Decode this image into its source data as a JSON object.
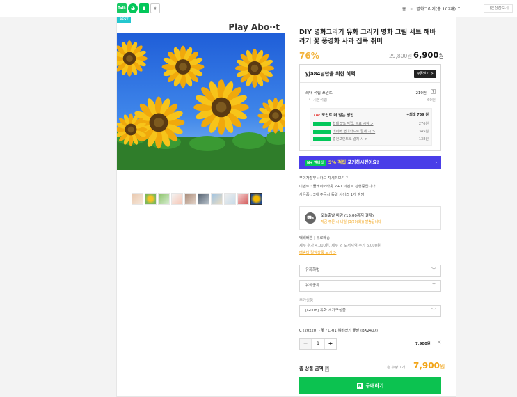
{
  "topbar": {
    "icons": [
      {
        "name": "smartstore-icon",
        "label": "Talk"
      },
      {
        "name": "store-logo-icon",
        "label": ""
      },
      {
        "name": "bookmark-icon",
        "label": ""
      },
      {
        "name": "share-icon",
        "label": ""
      }
    ],
    "breadcrumb_home": "홈",
    "breadcrumb_sep": ">",
    "breadcrumb_category": "명화그리기(총 102개)",
    "breadcrumb_toggle": "▾",
    "more_label": "다른상품보기"
  },
  "badge": {
    "best": "BEST"
  },
  "brand_overlay": "Play Abo··t",
  "colors": {
    "accent_green": "#0cc250",
    "discount": "#f2b23b",
    "banner": "#4a3ee8",
    "total": "#f2a51a"
  },
  "product": {
    "title": "DIY 명화그리기 유화 그리기 명화 그림 세트 해바라기 꽃 풍경화 사과 집콕 취미",
    "discount": "76%",
    "original_price": "29,800원",
    "price": "6,900",
    "price_unit": "원"
  },
  "benefit": {
    "title": "yja84님만을 위한 혜택",
    "coupon_button": "쿠폰받기 >",
    "max_points_label": "최대 적립 포인트",
    "max_points_value": "219원",
    "info_icon": "?",
    "basic_label": "기본적립",
    "basic_value": "69원",
    "tip_title_prefix": "TIP.",
    "tip_title": "포인트 더 받는 방법",
    "tip_total": "+최대 759 원",
    "tip_rows": [
      {
        "label": "최대 5% 적립, 무료 시작 >",
        "value": "276원"
      },
      {
        "label": "네이버 현대카드로 결제 시 >",
        "value": "345원"
      },
      {
        "label": "충전포인트로 결제 시 >",
        "value": "138원"
      }
    ]
  },
  "banner": {
    "prefix": "N+ 멤버십",
    "highlight": "5% 적립",
    "text": " 포기하시겠어요?"
  },
  "info_rows": [
    "무이자할부 : 카드 자세히보기 ?",
    "이벤트 : 플레이어바웃 2+1 이벤트 진행중입니다!",
    "사은품 : 3개 주문시 동일 사이즈 1개 랜덤!"
  ],
  "delivery": {
    "line1": "오늘출발 마감 (15:00까지 결제)",
    "line2": "지금 주문 시 내일 (3/29(화)) 발송됩니다"
  },
  "shipping": {
    "label": "택배배송 | 무료배송",
    "extra": "제주 추가 4,000원, 제주 외 도서지역 추가 6,000원",
    "link": "배송비 절약상품 보기 >"
  },
  "options": {
    "select1": "유화화법",
    "select2": "유화종류",
    "extra_label": "추가상품",
    "select3": "[G008] 유화 초가구성품",
    "chosen": "C (20x20) - 꽃 / C-01 해바라기 꽃밭 (BX2407)",
    "qty": "1",
    "minus": "−",
    "plus": "+",
    "chosen_price": "7,900원",
    "remove": "✕"
  },
  "total": {
    "label": "총 상품 금액",
    "info_icon": "?",
    "qty_label": "총 수량 1개",
    "price": "7,900",
    "unit": "원"
  },
  "buy_label": "구매하기"
}
